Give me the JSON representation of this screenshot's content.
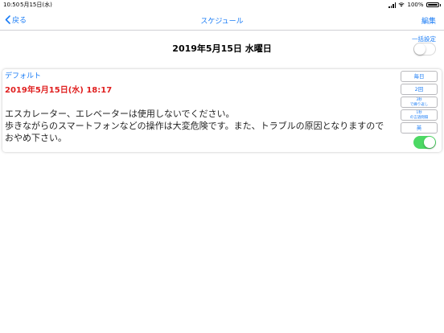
{
  "status_bar": {
    "time": "10:50",
    "date": "5月15日(水)",
    "battery": "100%"
  },
  "nav": {
    "back_label": "戻る",
    "title": "スケジュール",
    "edit_label": "編集"
  },
  "date_header": "2019年5月15日 水曜日",
  "bulk_setting": {
    "label": "一括設定",
    "enabled": false
  },
  "schedule_item": {
    "label": "デフォルト",
    "datetime": "2019年5月15日(水) 18:17",
    "message": "エスカレーター、エレベーターは使用しないでください。\n歩きながらのスマートフォンなどの操作は大変危険です。また、トラブルの原因となりますのでおやめ下さい。",
    "buttons": {
      "repeat": "毎日",
      "count": "2回",
      "interval_line1": "3秒",
      "interval_line2": "で繰り返し",
      "lead_line1": "1秒",
      "lead_line2": "の言語間隔",
      "language": "英"
    },
    "enabled": true
  },
  "colors": {
    "accent": "#1a7cf6",
    "datetime": "#e02020",
    "toggle_on": "#4cd964"
  }
}
